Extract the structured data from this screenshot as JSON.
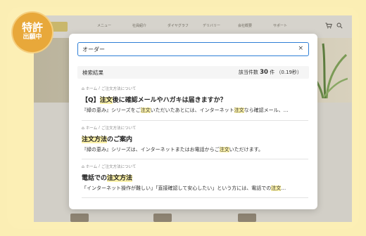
{
  "badge": {
    "line1": "特許",
    "line2": "出願中"
  },
  "site_nav": [
    "メニュー",
    "社員紹介",
    "ダイヤグラフ",
    "デリバリー",
    "会社概要",
    "サポート"
  ],
  "search": {
    "value": "オーダー",
    "clear_label": "×"
  },
  "results_header": {
    "title": "検索結果",
    "count_prefix": "該当件数",
    "count": "30",
    "count_suffix": "件 （0.19秒）"
  },
  "results": [
    {
      "breadcrumb": [
        "ホーム",
        "ご注文方法について"
      ],
      "title_parts": [
        {
          "t": "【Q】",
          "hl": false
        },
        {
          "t": "注文",
          "hl": true
        },
        {
          "t": "後に確認メールやハガキは届きますか？",
          "hl": false
        }
      ],
      "snippet_parts": [
        {
          "t": "『緑の恵み』シリーズをご",
          "hl": false
        },
        {
          "t": "注文",
          "hl": true
        },
        {
          "t": "いただいたあとには、インターネット",
          "hl": false
        },
        {
          "t": "注文",
          "hl": true
        },
        {
          "t": "なら確認メール、…",
          "hl": false
        }
      ]
    },
    {
      "breadcrumb": [
        "ホーム",
        "ご注文方法について"
      ],
      "title_parts": [
        {
          "t": "注文方法",
          "hl": true
        },
        {
          "t": "のご案内",
          "hl": false
        }
      ],
      "snippet_parts": [
        {
          "t": "『緑の恵み』シリーズは、インターネットまたはお電話からご",
          "hl": false
        },
        {
          "t": "注文",
          "hl": true
        },
        {
          "t": "いただけます。",
          "hl": false
        }
      ]
    },
    {
      "breadcrumb": [
        "ホーム",
        "ご注文方法について"
      ],
      "title_parts": [
        {
          "t": "電話での",
          "hl": false
        },
        {
          "t": "注文方法",
          "hl": true
        }
      ],
      "snippet_parts": [
        {
          "t": "「インターネット操作が難しい」「直接確認して安心したい」という方には、電話での",
          "hl": false
        },
        {
          "t": "注文",
          "hl": true
        },
        {
          "t": "…",
          "hl": false
        }
      ]
    }
  ],
  "icons": {
    "cart": "cart-icon",
    "search": "search-icon",
    "home": "home-icon"
  },
  "colors": {
    "accent": "#2f7fd6",
    "highlight": "#fbf1a9",
    "badge": "#e8a83a"
  }
}
